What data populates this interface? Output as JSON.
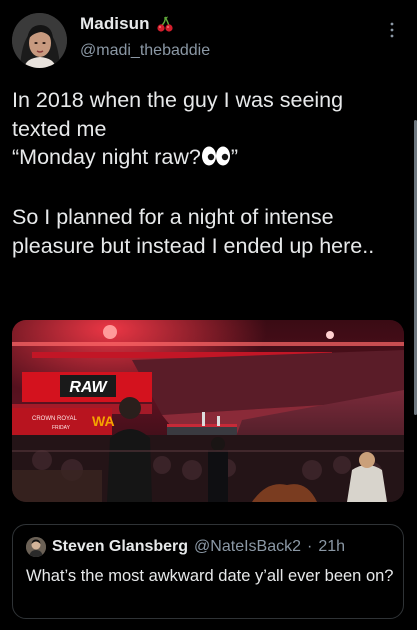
{
  "tweet": {
    "author": {
      "display_name": "Madisun",
      "name_emoji": "cherry-icon",
      "handle": "@madi_thebaddie"
    },
    "text_part1": "In 2018 when the guy I was seeing texted me\n“Monday night raw?",
    "text_emoji": "eyes-icon",
    "text_part2": "”\n\nSo I planned for a night of intense pleasure but instead I ended up here..",
    "media": {
      "description_icon": "arena-photo",
      "signage": [
        "RAW",
        "RAW",
        "CROWN ROYAL",
        "FRIDAY"
      ]
    },
    "more_icon": "more-vertical-icon"
  },
  "quoted_tweet": {
    "display_name": "Steven Glansberg",
    "handle": "@NateIsBack2",
    "separator": "·",
    "time": "21h",
    "text": "What’s the most awkward date y’all ever been on?"
  },
  "colors": {
    "background": "#000000",
    "primary_text": "#e7e9ea",
    "secondary_text": "#8b98a5",
    "border": "#2f3336",
    "raw_red": "#d4121e"
  }
}
